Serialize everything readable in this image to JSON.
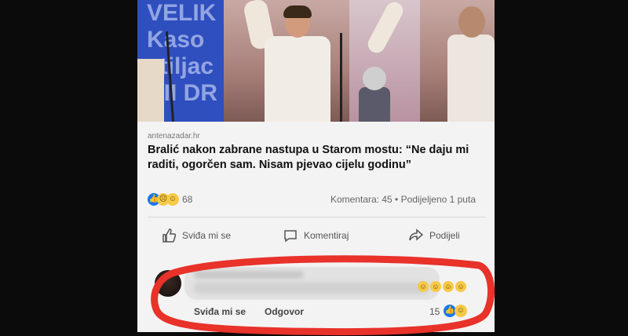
{
  "post": {
    "source": "antenazadar.hr",
    "headline": "Bralić nakon zabrane nastupa u Starom mostu: “Ne daju mi raditi, ogorčen sam. Nisam pjevao cijelu godinu”",
    "banner_text": [
      "VELIK",
      "Kaso",
      "stiljac",
      "DII DR"
    ],
    "reaction_count": "68",
    "stats": "Komentara: 45 • Podijeljeno 1 puta",
    "reaction_icons": [
      "like-icon",
      "sad-icon",
      "haha-icon"
    ]
  },
  "actions": {
    "like_label": "Sviđa mi se",
    "comment_label": "Komentiraj",
    "share_label": "Podijeli"
  },
  "comment": {
    "like_label": "Sviđa mi se",
    "reply_label": "Odgovor",
    "reaction_count": "15",
    "reaction_icons": [
      "like-icon",
      "haha-icon"
    ],
    "inline_emoji_icons": [
      "laugh-emoji-icon",
      "laugh-emoji-icon",
      "laugh-emoji-icon",
      "laugh-emoji-icon"
    ]
  },
  "colors": {
    "like_blue": "#1877f2",
    "emoji_yellow": "#f7c948",
    "highlight_red": "#e8322a"
  }
}
